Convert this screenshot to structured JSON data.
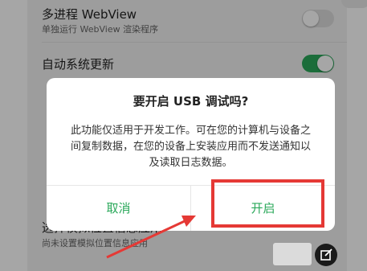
{
  "settings": {
    "items": [
      {
        "title": "多进程 WebView",
        "subtitle": "单独运行 WebView 渲染程序",
        "toggle": "off"
      },
      {
        "title": "自动系统更新",
        "toggle": "on"
      },
      {
        "title": "选择模拟位置信息应用",
        "subtitle": "尚未设置模拟位置信息应用"
      }
    ]
  },
  "dialog": {
    "title": "要开启 USB 调试吗?",
    "message": "此功能仅适用于开发工作。可在您的计算机与设备之间复制数据，在您的设备上安装应用而不发送通知以及读取日志数据。",
    "cancel_label": "取消",
    "confirm_label": "开启"
  },
  "colors": {
    "accent": "#2aa85a",
    "highlight": "#e53935",
    "toggle_off": "#dcdcdc"
  },
  "icons": {
    "edit": "edit-icon"
  }
}
